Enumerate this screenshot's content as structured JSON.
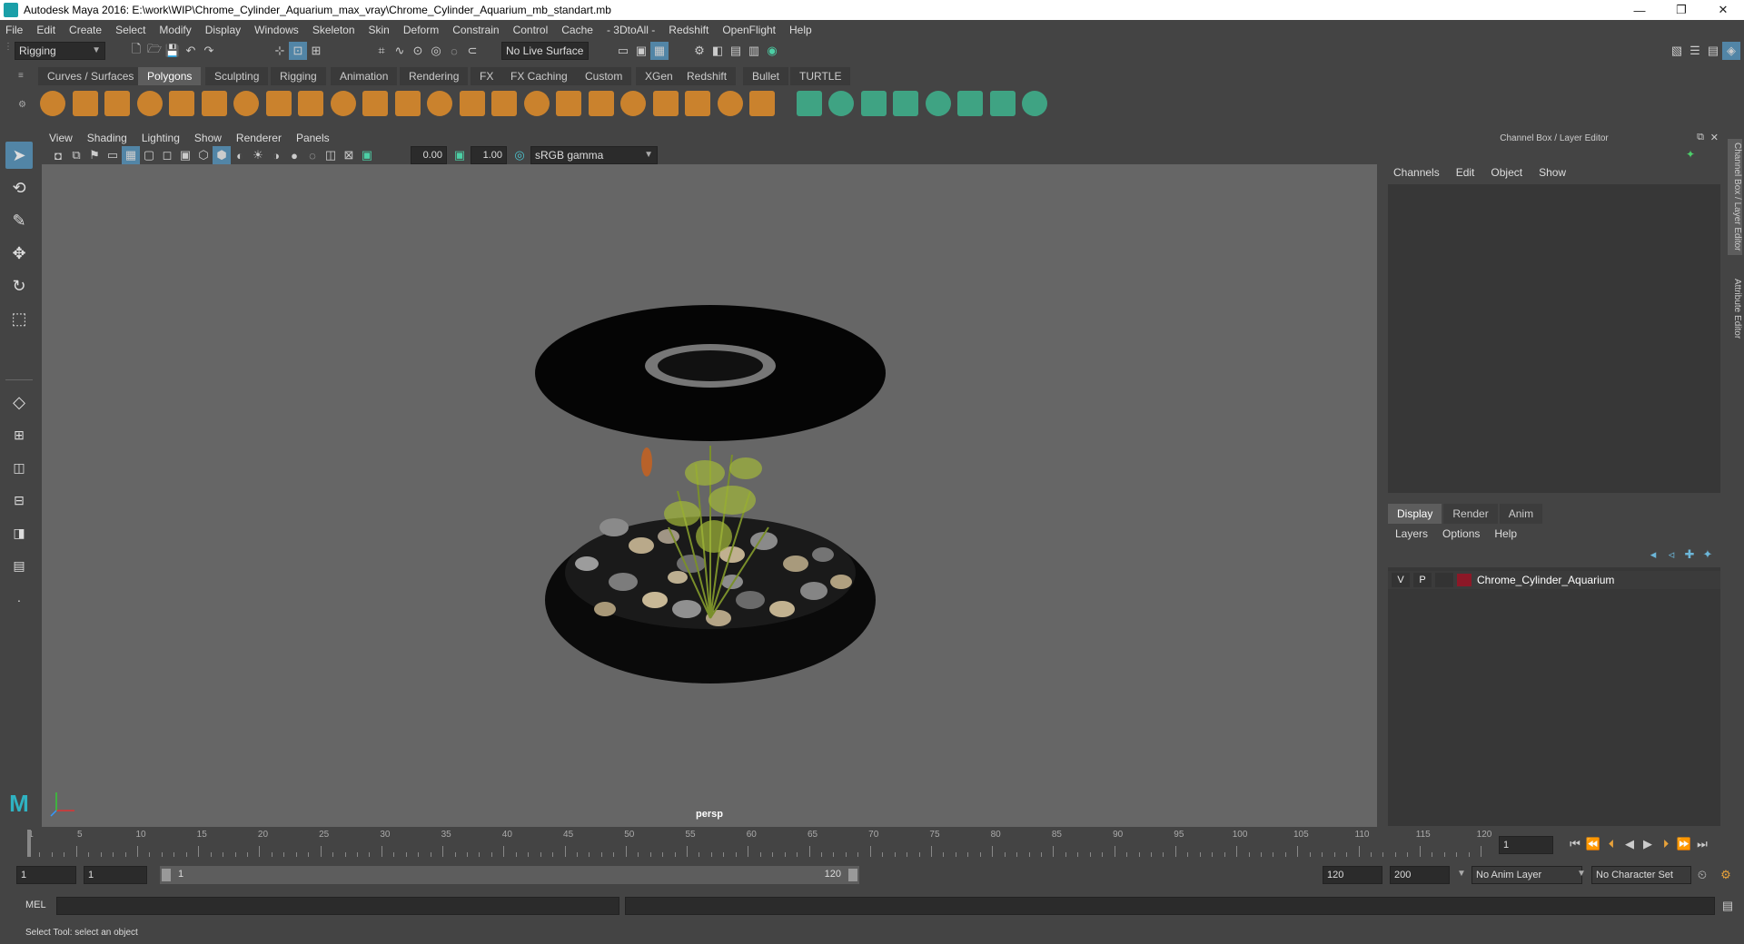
{
  "window": {
    "title": "Autodesk Maya 2016: E:\\work\\WIP\\Chrome_Cylinder_Aquarium_max_vray\\Chrome_Cylinder_Aquarium_mb_standart.mb",
    "minimize": "—",
    "restore": "❐",
    "close": "✕"
  },
  "menubar": [
    "File",
    "Edit",
    "Create",
    "Select",
    "Modify",
    "Display",
    "Windows",
    "Skeleton",
    "Skin",
    "Deform",
    "Constrain",
    "Control",
    "Cache",
    "- 3DtoAll -",
    "Redshift",
    "OpenFlight",
    "Help"
  ],
  "statusline": {
    "mode": "Rigging",
    "live_surface": "No Live Surface"
  },
  "shelf_tabs": [
    "Curves / Surfaces",
    "Polygons",
    "Sculpting",
    "Rigging",
    "Animation",
    "Rendering",
    "FX",
    "FX Caching",
    "Custom",
    "XGen",
    "Redshift",
    "Bullet",
    "TURTLE"
  ],
  "shelf_active": "Polygons",
  "panel": {
    "menu": [
      "View",
      "Shading",
      "Lighting",
      "Show",
      "Renderer",
      "Panels"
    ],
    "exposure": "0.00",
    "gamma": "1.00",
    "color_space": "sRGB gamma",
    "camera_label": "persp"
  },
  "right_panel": {
    "header": "Channel Box / Layer Editor",
    "cb_menu": [
      "Channels",
      "Edit",
      "Object",
      "Show"
    ],
    "tabs": [
      "Display",
      "Render",
      "Anim"
    ],
    "active_tab": "Display",
    "layer_menu": [
      "Layers",
      "Options",
      "Help"
    ],
    "layers": [
      {
        "v": "V",
        "p": "P",
        "name": "Chrome_Cylinder_Aquarium",
        "color": "#8c1827"
      }
    ],
    "side_tabs": [
      "Channel Box / Layer Editor",
      "Attribute Editor"
    ]
  },
  "timeline": {
    "tick_labels": [
      "1",
      "5",
      "10",
      "15",
      "20",
      "25",
      "30",
      "35",
      "40",
      "45",
      "50",
      "55",
      "60",
      "65",
      "70",
      "75",
      "80",
      "85",
      "90",
      "95",
      "100",
      "105",
      "110",
      "115",
      "120"
    ],
    "current_frame": "1"
  },
  "range": {
    "start": "1",
    "anim_start": "1",
    "slider_start": "1",
    "slider_end": "120",
    "anim_end": "120",
    "end": "200",
    "anim_layer": "No Anim Layer",
    "character_set": "No Character Set"
  },
  "cmdline": {
    "label": "MEL"
  },
  "helpline": {
    "text": "Select Tool: select an object"
  }
}
